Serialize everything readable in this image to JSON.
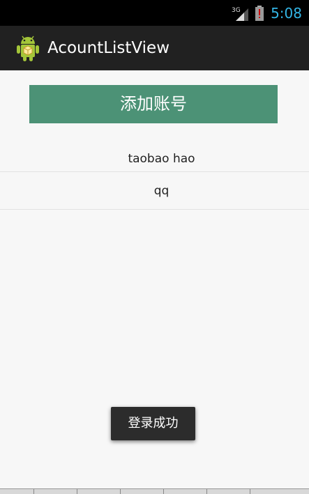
{
  "status_bar": {
    "network_label": "3G",
    "time": "5:08",
    "icons": [
      "signal-3g-icon",
      "battery-alert-icon"
    ]
  },
  "action_bar": {
    "icon": "android-app-icon",
    "title": "AcountListView"
  },
  "main": {
    "add_button_label": "添加账号",
    "accounts": [
      "taobao hao",
      "qq"
    ]
  },
  "toast": {
    "message": "登录成功"
  },
  "colors": {
    "button": "#4c9276",
    "action_bar": "#212121",
    "status_bar": "#000000",
    "clock": "#33b5e5",
    "background": "#f7f7f7"
  }
}
